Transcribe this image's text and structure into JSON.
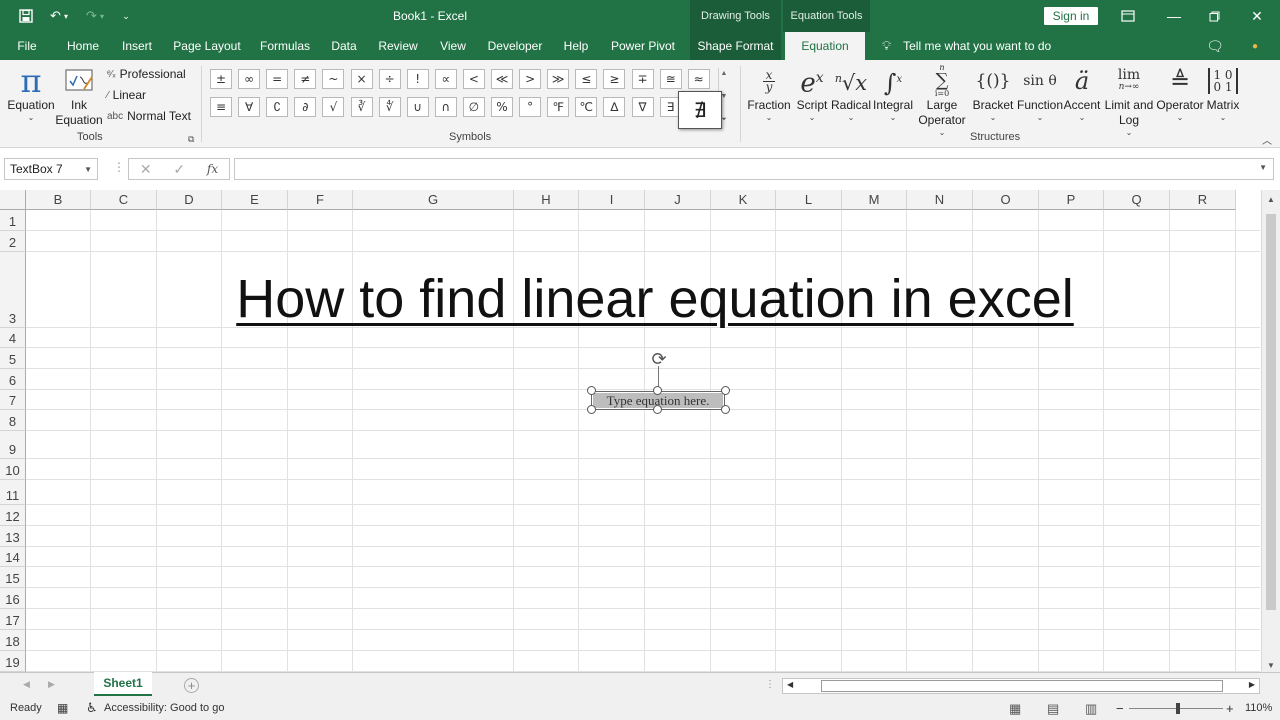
{
  "window": {
    "title": "Book1  -  Excel",
    "context_drawing": "Drawing Tools",
    "context_equation": "Equation Tools",
    "sign_in": "Sign in",
    "accent_color": "#217346"
  },
  "tabs": [
    "File",
    "Home",
    "Insert",
    "Page Layout",
    "Formulas",
    "Data",
    "Review",
    "View",
    "Developer",
    "Help",
    "Power Pivot",
    "Shape Format",
    "Equation"
  ],
  "active_tab": "Equation",
  "tell_me": "Tell me what you want to do",
  "ribbon": {
    "tools": {
      "equation": "Equation",
      "ink_equation_l1": "Ink",
      "ink_equation_l2": "Equation",
      "professional": "Professional",
      "linear": "Linear",
      "normal_text": "Normal Text",
      "label": "Tools"
    },
    "symbols": {
      "row1": [
        "±",
        "∞",
        "=",
        "≠",
        "~",
        "×",
        "÷",
        "!",
        "∝",
        "<",
        "≪",
        ">",
        "≫",
        "≤",
        "≥",
        "∓",
        "≅",
        "≈"
      ],
      "row2": [
        "≡",
        "∀",
        "∁",
        "∂",
        "√",
        "∛",
        "∜",
        "∪",
        "∩",
        "∅",
        "%",
        "°",
        "℉",
        "℃",
        "∆",
        "∇",
        "∃",
        "∄"
      ],
      "tooltip_symbol": "∄",
      "label": "Symbols"
    },
    "structures": {
      "items": [
        {
          "label1": "Fraction",
          "label2": ""
        },
        {
          "label1": "Script",
          "label2": ""
        },
        {
          "label1": "Radical",
          "label2": ""
        },
        {
          "label1": "Integral",
          "label2": ""
        },
        {
          "label1": "Large",
          "label2": "Operator"
        },
        {
          "label1": "Bracket",
          "label2": ""
        },
        {
          "label1": "Function",
          "label2": ""
        },
        {
          "label1": "Accent",
          "label2": ""
        },
        {
          "label1": "Limit and",
          "label2": "Log"
        },
        {
          "label1": "Operator",
          "label2": ""
        },
        {
          "label1": "Matrix",
          "label2": ""
        }
      ],
      "label": "Structures"
    }
  },
  "formula_bar": {
    "name_box": "TextBox 7",
    "fx": "fx",
    "value": ""
  },
  "sheet": {
    "columns": [
      "B",
      "C",
      "D",
      "E",
      "F",
      "G",
      "H",
      "I",
      "J",
      "K",
      "L",
      "M",
      "N",
      "O",
      "P",
      "Q",
      "R"
    ],
    "rows": [
      "1",
      "2",
      "3",
      "4",
      "5",
      "6",
      "7",
      "8",
      "9",
      "10",
      "11",
      "12",
      "13",
      "14",
      "15",
      "16",
      "17",
      "18",
      "19"
    ],
    "headline": "How to find linear equation in excel",
    "equation_placeholder": "Type equation here."
  },
  "sheet_tabs": [
    "Sheet1"
  ],
  "status": {
    "ready": "Ready",
    "accessibility": "Accessibility: Good to go",
    "zoom": "110%"
  }
}
